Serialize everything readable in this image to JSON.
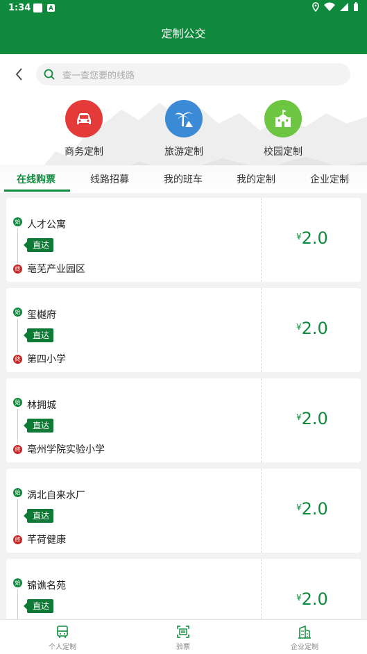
{
  "status_bar": {
    "time": "1:34",
    "notif_badge": "A"
  },
  "title": "定制公交",
  "search": {
    "placeholder": "查一查您要的线路"
  },
  "categories": [
    {
      "label": "商务定制",
      "icon": "car-icon",
      "color": "#e53a3a"
    },
    {
      "label": "旅游定制",
      "icon": "palm-tree-icon",
      "color": "#3b8ad6"
    },
    {
      "label": "校园定制",
      "icon": "school-icon",
      "color": "#6cc642"
    }
  ],
  "tabs": [
    {
      "label": "在线购票",
      "active": true
    },
    {
      "label": "线路招募"
    },
    {
      "label": "我的班车"
    },
    {
      "label": "我的定制"
    },
    {
      "label": "企业定制"
    }
  ],
  "route_markers": {
    "start": "始",
    "end": "终"
  },
  "routes": [
    {
      "start": "人才公寓",
      "end": "亳芜产业园区",
      "type": "直达",
      "currency": "¥",
      "price": "2.0"
    },
    {
      "start": "玺樾府",
      "end": "第四小学",
      "type": "直达",
      "currency": "¥",
      "price": "2.0"
    },
    {
      "start": "林拥城",
      "end": "亳州学院实验小学",
      "type": "直达",
      "currency": "¥",
      "price": "2.0"
    },
    {
      "start": "涡北自来水厂",
      "end": "芊荷健康",
      "type": "直达",
      "currency": "¥",
      "price": "2.0"
    },
    {
      "start": "锦谯名苑",
      "end": "",
      "type": "直达",
      "currency": "¥",
      "price": "2.0"
    }
  ],
  "bottom_nav": [
    {
      "label": "个人定制",
      "icon": "bus-icon"
    },
    {
      "label": "验票",
      "icon": "ticket-scan-icon"
    },
    {
      "label": "企业定制",
      "icon": "building-icon"
    }
  ],
  "colors": {
    "primary": "#0f8a3c",
    "end_marker": "#c62828"
  }
}
